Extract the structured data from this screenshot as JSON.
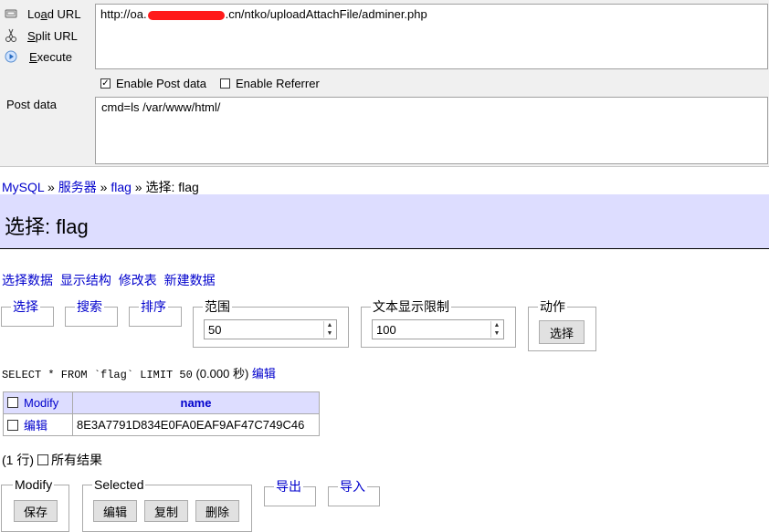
{
  "hackbar": {
    "load_url": {
      "prefix": "Lo",
      "key": "a",
      "suffix": "d URL"
    },
    "split_url": {
      "key": "S",
      "suffix": "plit URL"
    },
    "execute": {
      "key": "E",
      "suffix": "xecute"
    },
    "url_prefix": "http://oa.",
    "url_suffix": ".cn/ntko/uploadAttachFile/adminer.php",
    "enable_post": "Enable Post data",
    "enable_referrer": "Enable Referrer",
    "enable_post_checked": true,
    "enable_referrer_checked": false,
    "post_label": "Post data",
    "post_value": "cmd=ls /var/www/html/"
  },
  "breadcrumb": {
    "mysql": "MySQL",
    "sep": "»",
    "server": "服务器",
    "db": "flag",
    "current": "选择: flag"
  },
  "page": {
    "title": "选择: flag"
  },
  "links": [
    "选择数据",
    "显示结构",
    "修改表",
    "新建数据"
  ],
  "filters": {
    "select": "选择",
    "search": "搜索",
    "sort": "排序",
    "range_label": "范围",
    "range_value": "50",
    "text_limit_label": "文本显示限制",
    "text_limit_value": "100",
    "action_label": "动作",
    "action_button": "选择"
  },
  "query": {
    "sql": "SELECT * FROM `flag` LIMIT 50",
    "time": "(0.000 秒)",
    "edit": "编辑"
  },
  "table": {
    "header_modify": "Modify",
    "header_name": "name",
    "rows": [
      {
        "edit": "编辑",
        "name": "8E3A7791D834E0FA0EAF9AF47C749C46"
      }
    ]
  },
  "footer": {
    "count": "(1 行)",
    "all_results": "所有结果",
    "modify_legend": "Modify",
    "save": "保存",
    "selected_legend": "Selected",
    "edit": "编辑",
    "copy": "复制",
    "delete": "删除",
    "export": "导出",
    "import": "导入"
  }
}
